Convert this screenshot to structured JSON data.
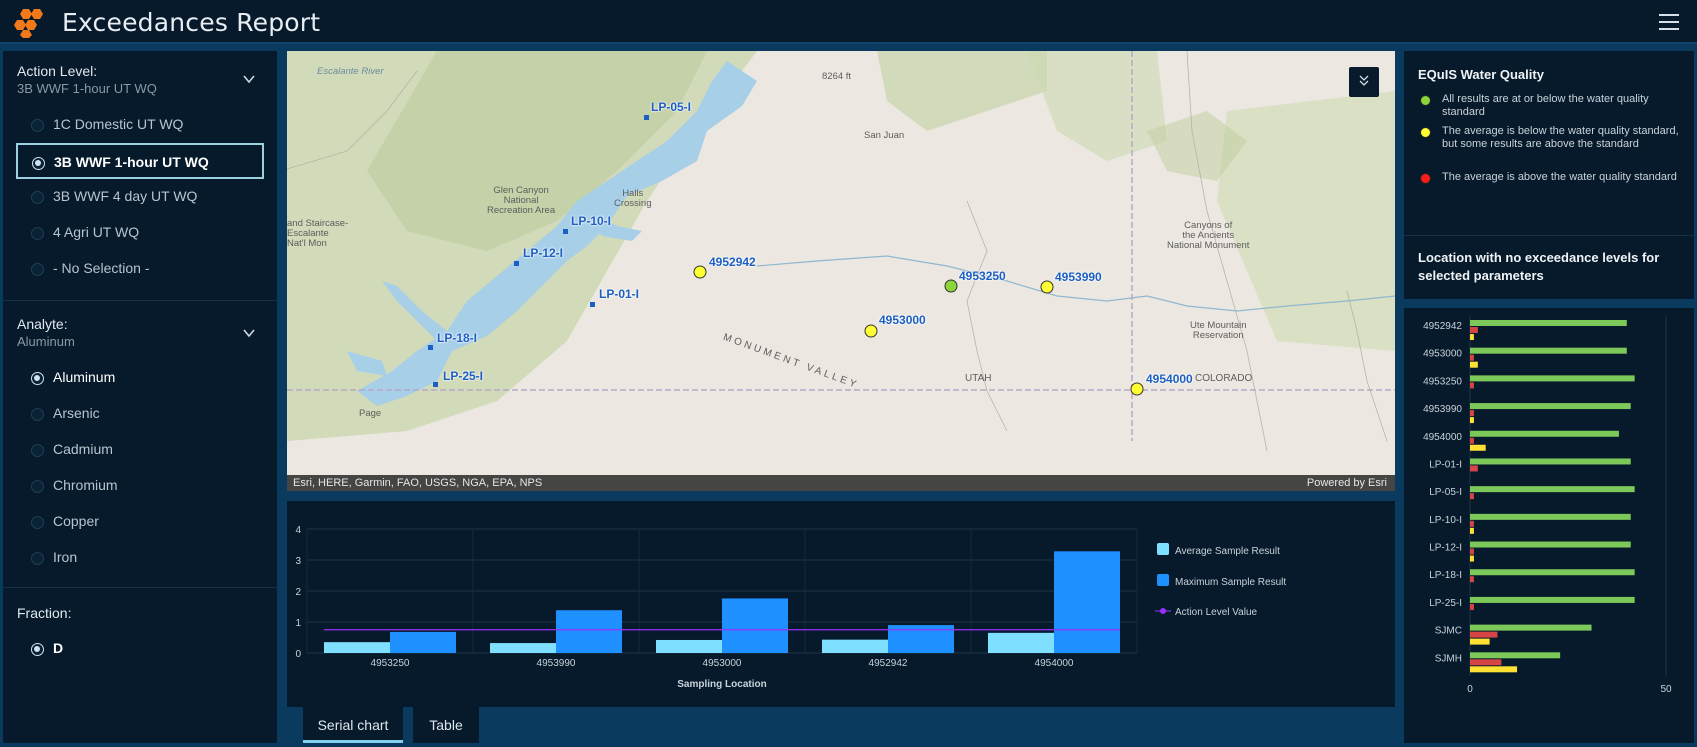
{
  "header": {
    "title": "Exceedances Report",
    "menu_icon": "hamburger-icon"
  },
  "action_level": {
    "title": "Action Level:",
    "selected": "3B WWF 1-hour UT WQ",
    "options": [
      "1C Domestic UT WQ",
      "3B WWF 1-hour UT WQ",
      "3B WWF 4 day UT WQ",
      "4 Agri UT WQ",
      "- No Selection -"
    ]
  },
  "analyte": {
    "title": "Analyte:",
    "selected": "Aluminum",
    "options": [
      "Aluminum",
      "Arsenic",
      "Cadmium",
      "Chromium",
      "Copper",
      "Iron"
    ]
  },
  "fraction": {
    "title": "Fraction:",
    "options": [
      "D"
    ]
  },
  "map": {
    "attribution": "Esri, HERE, Garmin, FAO, USGS, NGA, EPA, NPS",
    "powered_by": "Powered by Esri",
    "sites_lp": [
      "LP-05-I",
      "LP-10-I",
      "LP-12-I",
      "LP-01-I",
      "LP-18-I",
      "LP-25-I"
    ],
    "sites_wq": [
      {
        "id": "4952942",
        "status": "yellow"
      },
      {
        "id": "4953250",
        "status": "green"
      },
      {
        "id": "4953990",
        "status": "yellow"
      },
      {
        "id": "4953000",
        "status": "yellow"
      },
      {
        "id": "4954000",
        "status": "yellow"
      }
    ],
    "places": {
      "glen_canyon": "Glen Canyon\nNational\nRecreation Area",
      "halls_crossing": "Halls\nCrossing",
      "grand_staircase": "and Staircase-\nEscalante\nNat'l Mon",
      "san_juan": "San Juan",
      "monument_valley": "MONUMENT VALLEY",
      "utah": "UTAH",
      "colorado": "COLORADO",
      "page": "Page",
      "ute_mountain": "Ute Mountain\nReservation",
      "canyons": "Canyons of\nthe Ancients\nNational Monument",
      "peak": "8264 ft",
      "escalante_river": "Escalante River"
    }
  },
  "chart_data": {
    "type": "bar",
    "categories": [
      "4953250",
      "4953990",
      "4953000",
      "4952942",
      "4954000"
    ],
    "series": [
      {
        "name": "Average Sample Result",
        "values": [
          0.35,
          0.32,
          0.42,
          0.43,
          0.65
        ],
        "color": "#7fdfff"
      },
      {
        "name": "Maximum Sample Result",
        "values": [
          0.68,
          1.38,
          1.76,
          0.9,
          3.28
        ],
        "color": "#1e90ff"
      }
    ],
    "action_level": {
      "name": "Action Level Value",
      "value": 0.75,
      "color": "#9b30ff"
    },
    "xlabel": "Sampling Location",
    "ylabel": "",
    "ylim": [
      0,
      4
    ],
    "yticks": [
      0,
      1,
      2,
      3,
      4
    ],
    "grid": true,
    "legend": "right"
  },
  "tabs": [
    {
      "label": "Serial chart",
      "active": true
    },
    {
      "label": "Table",
      "active": false
    }
  ],
  "legend": {
    "title": "EQuIS Water Quality",
    "items": [
      {
        "color": "#8ad63a",
        "text": "All results are at or below the water quality standard"
      },
      {
        "color": "#ffff33",
        "text": "The average is below the water quality standard, but some results are above the standard"
      },
      {
        "color": "#ff1a1a",
        "text": "The average is above the water quality standard"
      }
    ],
    "subtitle": "Location with no exceedance levels for selected parameters"
  },
  "bar_chart": {
    "type": "bar",
    "orientation": "horizontal",
    "categories": [
      "4952942",
      "4953000",
      "4953250",
      "4953990",
      "4954000",
      "LP-01-I",
      "LP-05-I",
      "LP-10-I",
      "LP-12-I",
      "LP-18-I",
      "LP-25-I",
      "SJMC",
      "SJMH"
    ],
    "series": [
      {
        "color": "#7cc95a",
        "values": [
          40,
          40,
          42,
          41,
          38,
          41,
          42,
          41,
          41,
          42,
          42,
          31,
          23
        ]
      },
      {
        "color": "#d64545",
        "values": [
          2,
          1,
          1,
          1,
          1,
          2,
          1,
          1,
          1,
          1,
          1,
          7,
          8
        ]
      },
      {
        "color": "#ffe033",
        "values": [
          1,
          2,
          0,
          1,
          4,
          0,
          0,
          1,
          1,
          0,
          0,
          5,
          12
        ]
      }
    ],
    "xlim": [
      0,
      50
    ],
    "xticks": [
      0,
      50
    ]
  }
}
